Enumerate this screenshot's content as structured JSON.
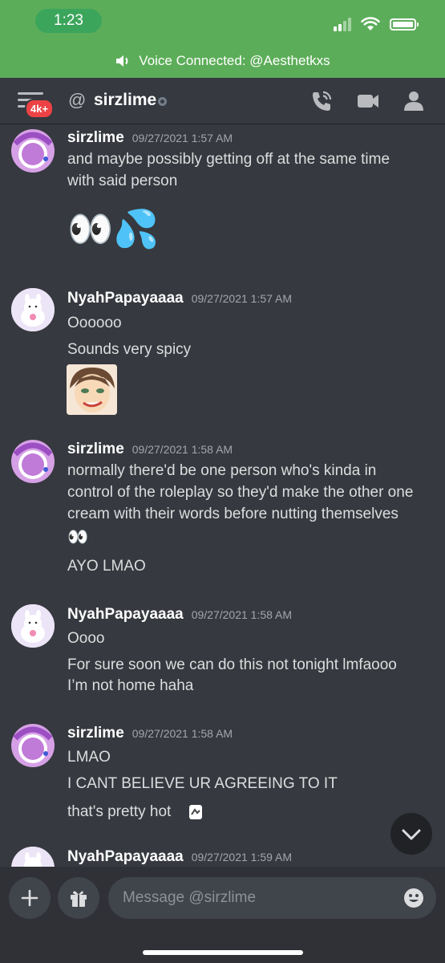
{
  "status_bar": {
    "time": "1:23"
  },
  "voice": {
    "text": "Voice Connected: @Aesthetkxs"
  },
  "header": {
    "badge": "4k+",
    "at_symbol": "@",
    "channel": "sirzlime"
  },
  "messages": [
    {
      "author": "sirzlime",
      "timestamp": "09/27/2021 1:57 AM",
      "lines": [
        "and maybe possibly getting off at the same time",
        "with said person"
      ],
      "emoji": "👀💦"
    },
    {
      "author": "NyahPapayaaaa",
      "timestamp": "09/27/2021 1:57 AM",
      "lines": [
        "Oooooo",
        "Sounds very spicy"
      ]
    },
    {
      "author": "sirzlime",
      "timestamp": "09/27/2021 1:58 AM",
      "lines": [
        "normally there'd be one person who's kinda in",
        "control of the roleplay so they'd make the other one",
        "cream with their words before nutting themselves",
        "👀",
        "AYO LMAO"
      ]
    },
    {
      "author": "NyahPapayaaaa",
      "timestamp": "09/27/2021 1:58 AM",
      "lines": [
        "Oooo",
        "For sure soon we can do this not tonight lmfaooo",
        "I’m not home haha"
      ]
    },
    {
      "author": "sirzlime",
      "timestamp": "09/27/2021 1:58 AM",
      "lines": [
        "LMAO",
        "I CANT BELIEVE UR AGREEING TO IT",
        "that's pretty hot"
      ]
    },
    {
      "author": "NyahPapayaaaa",
      "timestamp": "09/27/2021 1:59 AM",
      "lines": []
    }
  ],
  "composer": {
    "placeholder": "Message @sirzlime"
  },
  "colors": {
    "background": "#36393f",
    "voice_bar": "#5cad59",
    "badge": "#ed4245"
  },
  "icons": [
    "signal-icon",
    "wifi-icon",
    "battery-icon",
    "speaker-icon",
    "hamburger-icon",
    "call-icon",
    "video-icon",
    "members-icon",
    "chevron-down-icon",
    "plus-icon",
    "gift-icon",
    "emoji-icon"
  ]
}
